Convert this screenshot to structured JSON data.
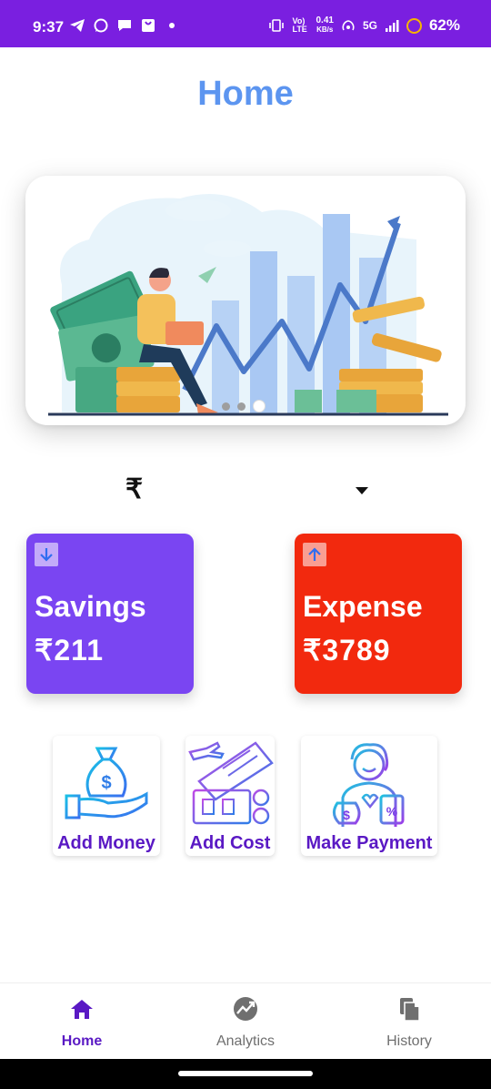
{
  "status_bar": {
    "time": "9:37",
    "network_label": "5G",
    "speed_value": "0.41",
    "speed_unit": "KB/s",
    "volte_label": "Vo) LTE",
    "battery_text": "62%",
    "icons": [
      "telegram-icon",
      "whatsapp-icon",
      "chat-icon",
      "shopping-bag-icon",
      "notification-dot-icon",
      "vibrate-icon",
      "hotspot-icon",
      "signal-icon",
      "battery-icon"
    ]
  },
  "header": {
    "title": "Home"
  },
  "carousel": {
    "slide_count": 3,
    "active_index": 2
  },
  "currency": {
    "symbol": "₹",
    "dropdown_icon": "caret-down-icon"
  },
  "cards": {
    "savings": {
      "label": "Savings",
      "amount": "₹211",
      "icon": "arrow-down-icon",
      "color": "#7a45f2"
    },
    "expense": {
      "label": "Expense",
      "amount": "₹3789",
      "icon": "arrow-up-icon",
      "color": "#f2290e"
    }
  },
  "actions": {
    "add_money": {
      "label": "Add Money",
      "icon": "money-bag-hand-icon"
    },
    "add_cost": {
      "label": "Add Cost",
      "icon": "travel-cost-icon"
    },
    "make_payment": {
      "label": "Make Payment",
      "icon": "person-payment-icon"
    }
  },
  "bottom_nav": {
    "items": [
      {
        "label": "Home",
        "icon": "home-icon",
        "active": true
      },
      {
        "label": "Analytics",
        "icon": "analytics-icon",
        "active": false
      },
      {
        "label": "History",
        "icon": "history-icon",
        "active": false
      }
    ]
  },
  "colors": {
    "status_bar": "#7a1fe0",
    "title": "#5c95f0",
    "accent": "#5a19c4"
  }
}
